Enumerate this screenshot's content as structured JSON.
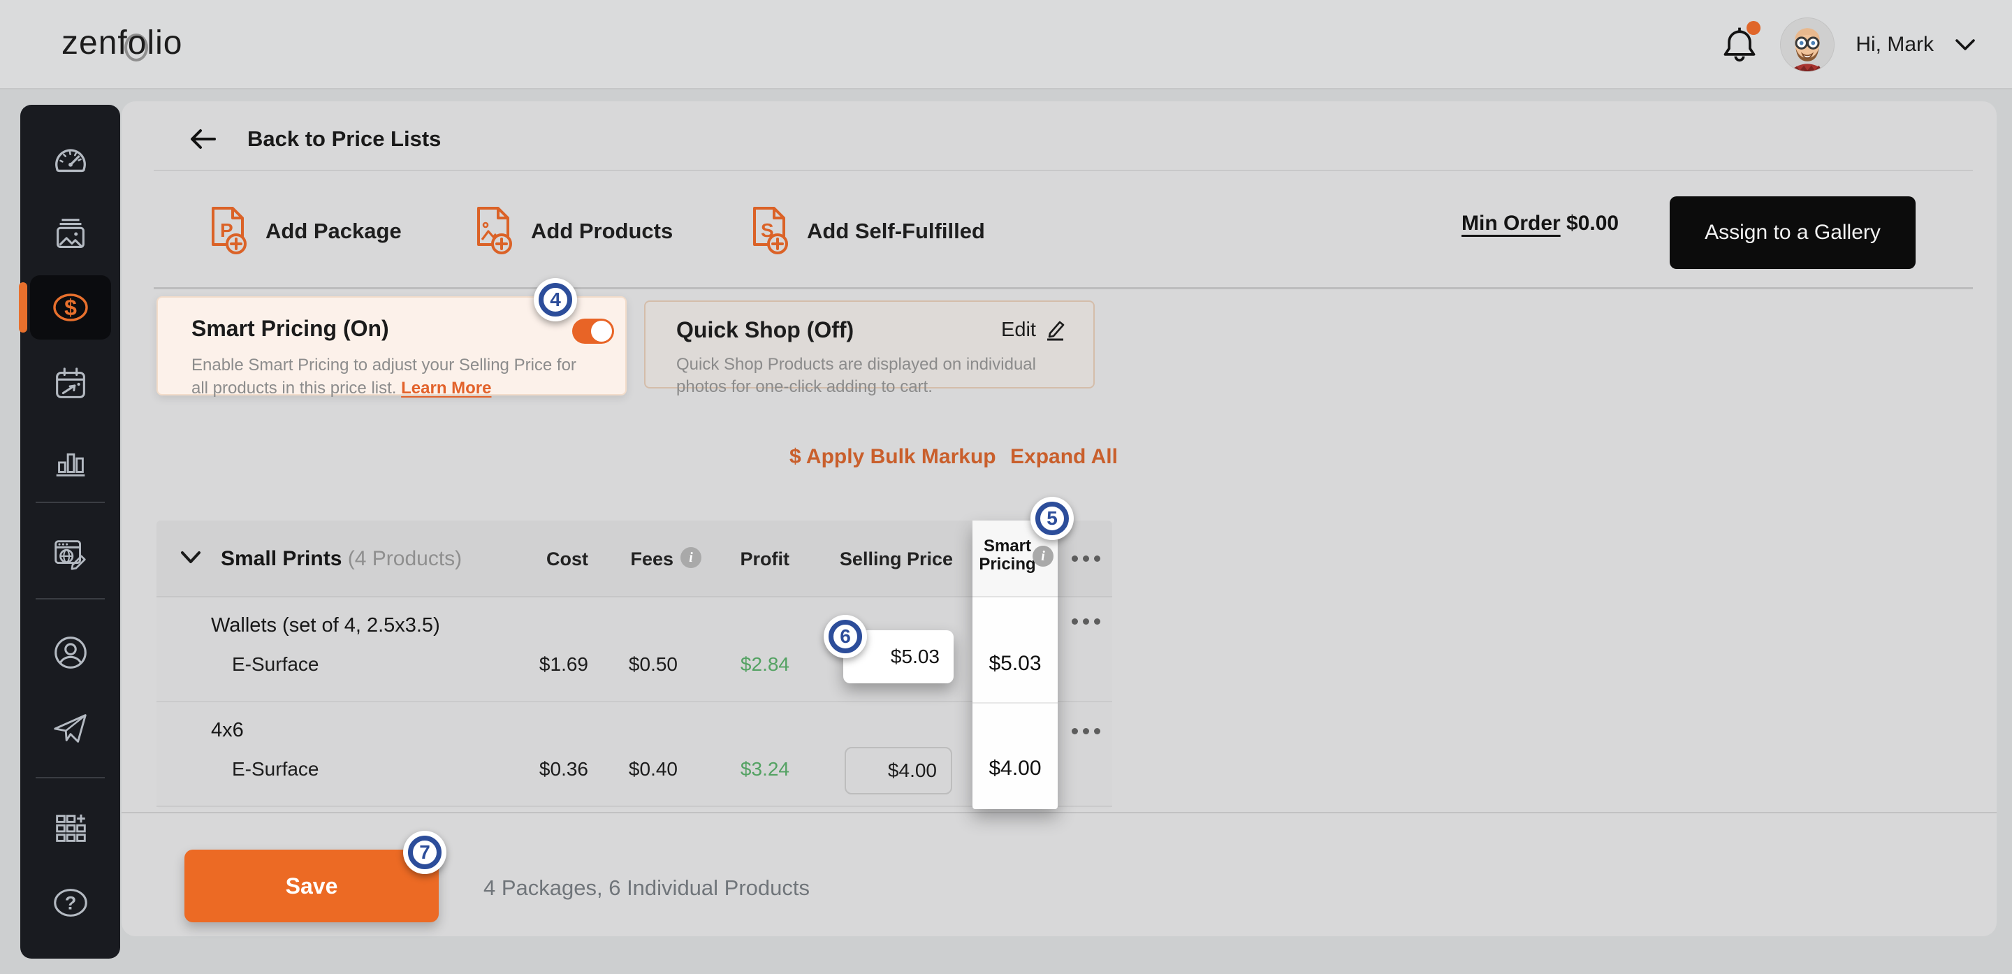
{
  "header": {
    "logo": "zenfolio",
    "greeting": "Hi, Mark"
  },
  "sidebar": {
    "items": [
      {
        "name": "dashboard",
        "icon": "speedometer-icon",
        "active": false
      },
      {
        "name": "galleries",
        "icon": "photos-icon",
        "active": false
      },
      {
        "name": "selling",
        "icon": "dollar-icon",
        "active": true
      },
      {
        "name": "bookings",
        "icon": "calendar-icon",
        "active": false
      },
      {
        "name": "statistics",
        "icon": "bar-chart-icon",
        "active": false
      },
      {
        "name": "website",
        "icon": "web-editor-icon",
        "active": false
      },
      {
        "name": "account",
        "icon": "person-icon",
        "active": false
      },
      {
        "name": "marketing",
        "icon": "paper-plane-icon",
        "active": false
      },
      {
        "name": "apps",
        "icon": "grid-plus-icon",
        "active": false
      },
      {
        "name": "help",
        "icon": "question-icon",
        "active": false
      }
    ]
  },
  "toolbar": {
    "back_label": "Back to Price Lists",
    "add_package": "Add Package",
    "add_products": "Add Products",
    "add_self_fulfilled": "Add Self-Fulfilled",
    "min_order_label": "Min Order",
    "min_order_value": "$0.00",
    "assign_button": "Assign to a Gallery"
  },
  "smart_pricing_card": {
    "step": "4",
    "title": "Smart Pricing (On)",
    "description": "Enable Smart Pricing to adjust your Selling Price for all products in this price list.",
    "learn_more": "Learn More",
    "toggle_state": "on"
  },
  "quick_shop_card": {
    "title": "Quick Shop (Off)",
    "edit_label": "Edit",
    "description": "Quick Shop Products are displayed on individual photos for one-click adding to cart."
  },
  "actions": {
    "bulk_markup": "$ Apply Bulk Markup",
    "expand_all": "Expand All"
  },
  "table": {
    "group_title": "Small Prints",
    "group_count": "(4 Products)",
    "columns": {
      "cost": "Cost",
      "fees": "Fees",
      "profit": "Profit",
      "selling_price": "Selling Price",
      "smart_pricing": "Smart Pricing"
    },
    "smart_column_step": "5",
    "rows": [
      {
        "product": "Wallets (set of 4, 2.5x3.5)",
        "variant": "E-Surface",
        "cost": "$1.69",
        "fees": "$0.50",
        "profit": "$2.84",
        "selling_price": "$5.03",
        "smart_pricing": "$5.03",
        "step": "6"
      },
      {
        "product": "4x6",
        "variant": "E-Surface",
        "cost": "$0.36",
        "fees": "$0.40",
        "profit": "$3.24",
        "selling_price": "$4.00",
        "smart_pricing": "$4.00"
      }
    ]
  },
  "footer": {
    "step": "7",
    "save_button": "Save",
    "summary": "4 Packages, 6 Individual Products"
  },
  "icons": {
    "info": "i",
    "ellipsis": "•••"
  },
  "colors": {
    "accent_orange": "#E86426",
    "link_orange": "#C95F2C",
    "badge_blue": "#2C4D9A",
    "profit_green": "#54A263",
    "sidebar_dark": "#191B20",
    "highlight_white": "#FFFFFF",
    "smart_card_bg": "#FCF1EA"
  }
}
